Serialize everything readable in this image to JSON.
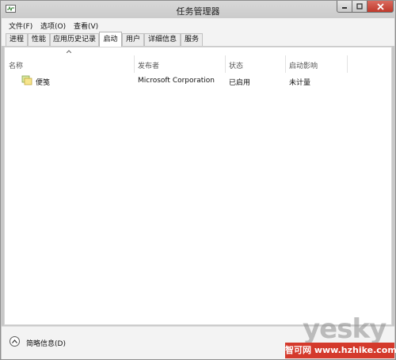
{
  "window": {
    "title": "任务管理器"
  },
  "menu": [
    "文件(F)",
    "选项(O)",
    "查看(V)"
  ],
  "tabs": [
    {
      "label": "进程",
      "active": false
    },
    {
      "label": "性能",
      "active": false
    },
    {
      "label": "应用历史记录",
      "active": false
    },
    {
      "label": "启动",
      "active": true
    },
    {
      "label": "用户",
      "active": false
    },
    {
      "label": "详细信息",
      "active": false
    },
    {
      "label": "服务",
      "active": false
    }
  ],
  "table": {
    "columns": [
      "名称",
      "发布者",
      "状态",
      "启动影响"
    ],
    "rows": [
      {
        "icon": "app-icon",
        "name": "便笺",
        "publisher": "Microsoft Corporation",
        "status": "已启用",
        "impact": "未计量"
      }
    ]
  },
  "footer": {
    "fewer_details": "简略信息(D)"
  },
  "watermark": {
    "logo": "yesky",
    "site": "智可网 www.hzhike.com"
  },
  "colors": {
    "close_button": "#c0392b",
    "accent": "#d43a2c"
  }
}
